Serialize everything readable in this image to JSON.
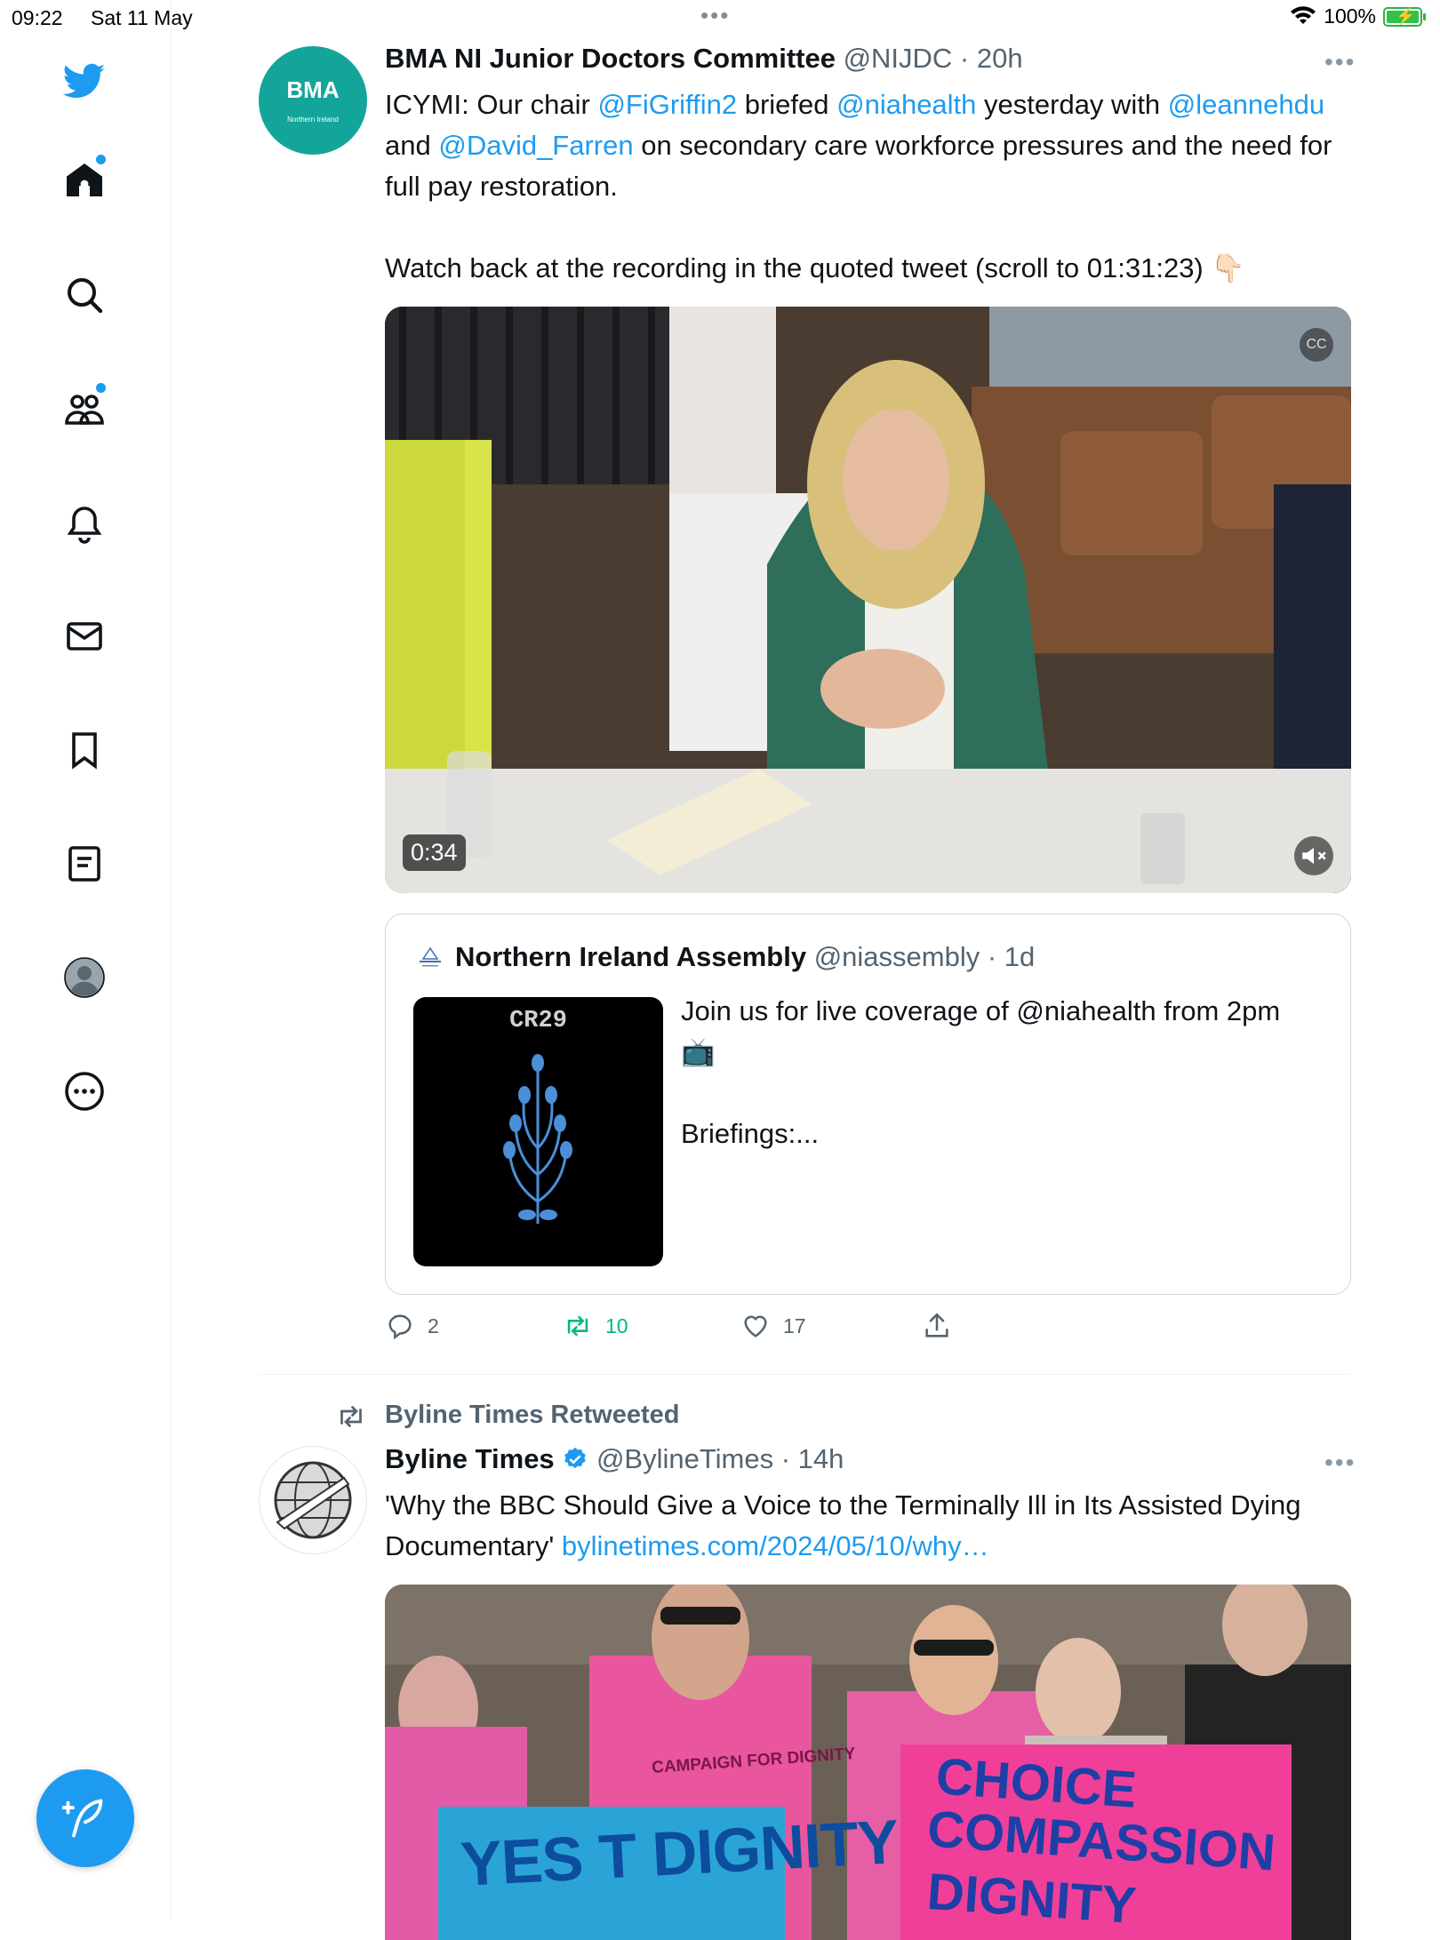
{
  "status_bar": {
    "time": "09:22",
    "date": "Sat 11 May",
    "battery": "100%"
  },
  "sidebar": {
    "items": [
      "twitter-logo",
      "home",
      "search",
      "communities",
      "notifications",
      "messages",
      "bookmarks",
      "lists",
      "profile",
      "more"
    ]
  },
  "tweet1": {
    "name": "BMA NI Junior Doctors Committee",
    "meta": "@NIJDC · 20h",
    "avatar_text": "BMA",
    "avatar_sub": "Northern Ireland",
    "text": {
      "p1": "ICYMI: Our chair ",
      "m1": "@FiGriffin2",
      "p2": " briefed ",
      "m2": "@niahealth",
      "p3": " yesterday with ",
      "m3": "@leannehdu",
      "p4": " and ",
      "m4": "@David_Farren",
      "p5": " on secondary care workforce pressures and the need for full pay restoration.",
      "p6": "Watch back at the recording in the quoted tweet (scroll to 01:31:23) 👇🏻"
    },
    "video_duration": "0:34",
    "quote": {
      "name": "Northern Ireland Assembly",
      "meta": "@niassembly · 1d",
      "thumb_label": "CR29",
      "text1": "Join us for live coverage of @niahealth from 2pm 📺",
      "text2": "Briefings:..."
    },
    "replies": "2",
    "retweets": "10",
    "likes": "17"
  },
  "tweet2": {
    "retweet_label": "Byline Times Retweeted",
    "name": "Byline Times",
    "meta": "@BylineTimes · 14h",
    "text": "'Why the BBC Should Give a Voice to the Terminally Ill in Its Assisted Dying Documentary' ",
    "link": "bylinetimes.com/2024/05/10/why…",
    "image_signs": {
      "shirt": "CAMPAIGN FOR DIGNITY",
      "blue_sign": "YES T DIGNITY",
      "pink_sign_1": "CHOICE",
      "pink_sign_2": "COMPASSION",
      "pink_sign_3": "DIGNITY"
    }
  },
  "colors": {
    "accent": "#1d9bf0",
    "retweet_green": "#00ba7c",
    "text": "#0f1419",
    "muted": "#536471"
  }
}
